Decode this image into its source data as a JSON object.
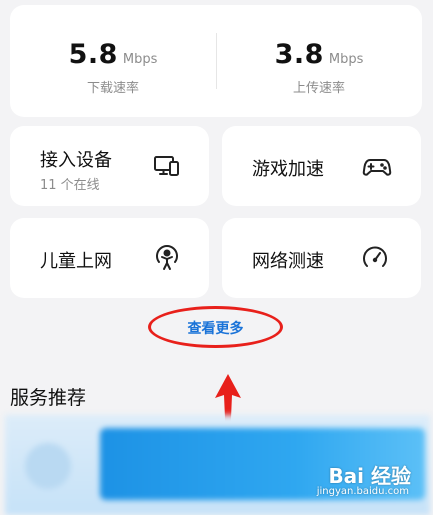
{
  "speed": {
    "download": {
      "value": "5.8",
      "unit": "Mbps",
      "label": "下载速率"
    },
    "upload": {
      "value": "3.8",
      "unit": "Mbps",
      "label": "上传速率"
    }
  },
  "tiles": [
    {
      "title": "接入设备",
      "subtitle": "11 个在线",
      "icon": "devices-icon"
    },
    {
      "title": "游戏加速",
      "icon": "gamepad-icon"
    },
    {
      "title": "儿童上网",
      "icon": "child-icon"
    },
    {
      "title": "网络测速",
      "icon": "speedometer-icon"
    }
  ],
  "more": {
    "label": "查看更多",
    "highlight_color": "#e8201b",
    "link_color": "#1a73d8"
  },
  "services": {
    "title": "服务推荐"
  },
  "watermark": {
    "logo": "Bai 经验",
    "url": "jingyan.baidu.com"
  },
  "colors": {
    "background": "#f3f3f5",
    "card": "#ffffff",
    "annotation": "#e8201b"
  }
}
